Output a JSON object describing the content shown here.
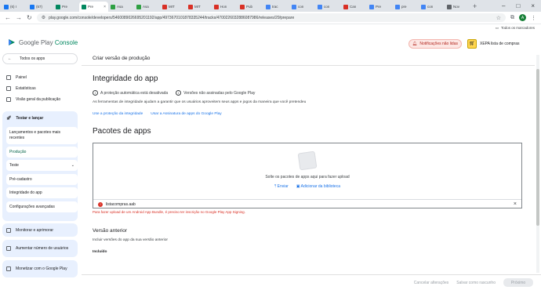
{
  "browser": {
    "tabs": [
      {
        "title": "(6) I",
        "color": "#1877f2"
      },
      {
        "title": "(57)",
        "color": "#1877f2"
      },
      {
        "title": "Pre",
        "color": "#01875f"
      },
      {
        "title": "Pre",
        "color": "#01875f",
        "active": true
      },
      {
        "title": "Asa",
        "color": "#2ea043"
      },
      {
        "title": "Asa",
        "color": "#2ea043"
      },
      {
        "title": "MIT",
        "color": "#d93025"
      },
      {
        "title": "MIT",
        "color": "#d93025"
      },
      {
        "title": "Hon",
        "color": "#d93025"
      },
      {
        "title": "Pub",
        "color": "#d93025"
      },
      {
        "title": "trac",
        "color": "#4285f4"
      },
      {
        "title": "con",
        "color": "#4285f4"
      },
      {
        "title": "con",
        "color": "#4285f4"
      },
      {
        "title": "Can",
        "color": "#d93025"
      },
      {
        "title": "Pre",
        "color": "#4285f4"
      },
      {
        "title": "pre",
        "color": "#4285f4"
      },
      {
        "title": "con",
        "color": "#4285f4"
      },
      {
        "title": "Nov",
        "color": "#5f6368"
      }
    ],
    "url": "play.google.com/console/developers/5460089026695201192/app/4973670101878335244/tracks/4700226032886087986/releases/29/prepare",
    "avatar_letter": "A",
    "bookmarks_label": "Todos os marcadores"
  },
  "header": {
    "logo_part1": "Google Play",
    "logo_part2": " Console",
    "notifications": "Notificações não lidas",
    "app_name": "XEPA lista de compras"
  },
  "sidebar": {
    "all_apps": "Todos os apps",
    "items": [
      "Painel",
      "Estatísticas",
      "Visão geral da publicação"
    ],
    "test_release": {
      "title": "Testar e lançar",
      "subitems": [
        "Lançamentos e pacotes mais recentes",
        "Produção",
        "Teste",
        "Pré-cadastro",
        "Integridade do app",
        "Configurações avançadas"
      ]
    },
    "collapsed": [
      "Monitorar e aprimorar",
      "Aumentar número de usuários",
      "Monetizar com o Google Play"
    ]
  },
  "main": {
    "breadcrumb": "Criar versão de produção",
    "integrity_title": "Integridade do app",
    "status1": "A proteção automática está desativada",
    "status2": "Versões não assinadas pelo Google Play",
    "integrity_desc": "As ferramentas de integridade ajudam a garantir que os usuários aproveitem seus apps e jogos da maneira que você pretendeu",
    "link1": "Use a proteção da integridade",
    "link2": "Usar a Assinatura de apps do Google Play",
    "bundles_title": "Pacotes de apps",
    "drop_text": "Solte os pacotes de apps aqui para fazer upload",
    "upload_label": "Enviar",
    "library_label": "Adicionar da biblioteca",
    "file_name": "listacompras.aab",
    "error_msg": "Para fazer upload de um Android App Bundle, é preciso ter inscrição no Google Play App Signing.",
    "prev_title": "Versão anterior",
    "prev_desc": "Incluir versões do app da sua versão anterior",
    "included": "Incluído"
  },
  "footer": {
    "discard": "Cancelar alterações",
    "save": "Salvar como rascunho",
    "next": "Próximo"
  }
}
